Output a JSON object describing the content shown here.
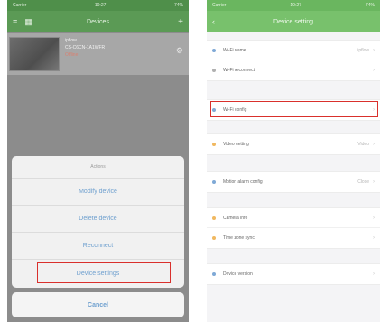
{
  "left": {
    "status": {
      "carrier": "Carrier",
      "time": "10:27",
      "battery": "74%"
    },
    "title": "Devices",
    "device": {
      "name": "ipflow",
      "id": "CS-C6CN-1A1WFR",
      "state": "Offline"
    },
    "sheet": {
      "header": "Actions",
      "items": [
        "Modify device",
        "Delete device",
        "Reconnect",
        "Device settings"
      ],
      "cancel": "Cancel"
    }
  },
  "right": {
    "status": {
      "carrier": "Carrier",
      "time": "10:27",
      "battery": "74%"
    },
    "title": "Device setting",
    "sections": [
      {
        "rows": [
          {
            "label": "Wi-Fi name",
            "value": "ipflow",
            "dot": "#7fa9d6"
          },
          {
            "label": "Wi-Fi reconnect",
            "value": "",
            "dot": "#b0b0b0"
          }
        ]
      },
      {
        "rows": [
          {
            "label": "Wi-Fi config",
            "value": "",
            "dot": "#7fa9d6"
          }
        ]
      },
      {
        "rows": [
          {
            "label": "Video setting",
            "value": "Video",
            "dot": "#f0b860"
          }
        ]
      },
      {
        "rows": [
          {
            "label": "Motion alarm config",
            "value": "Close",
            "dot": "#7fa9d6"
          }
        ]
      },
      {
        "rows": [
          {
            "label": "Camera info",
            "value": "",
            "dot": "#f0b860"
          },
          {
            "label": "Time zone sync",
            "value": "",
            "dot": "#f0b860"
          }
        ]
      },
      {
        "rows": [
          {
            "label": "Device version",
            "value": "",
            "dot": "#7fa9d6"
          }
        ]
      }
    ]
  }
}
